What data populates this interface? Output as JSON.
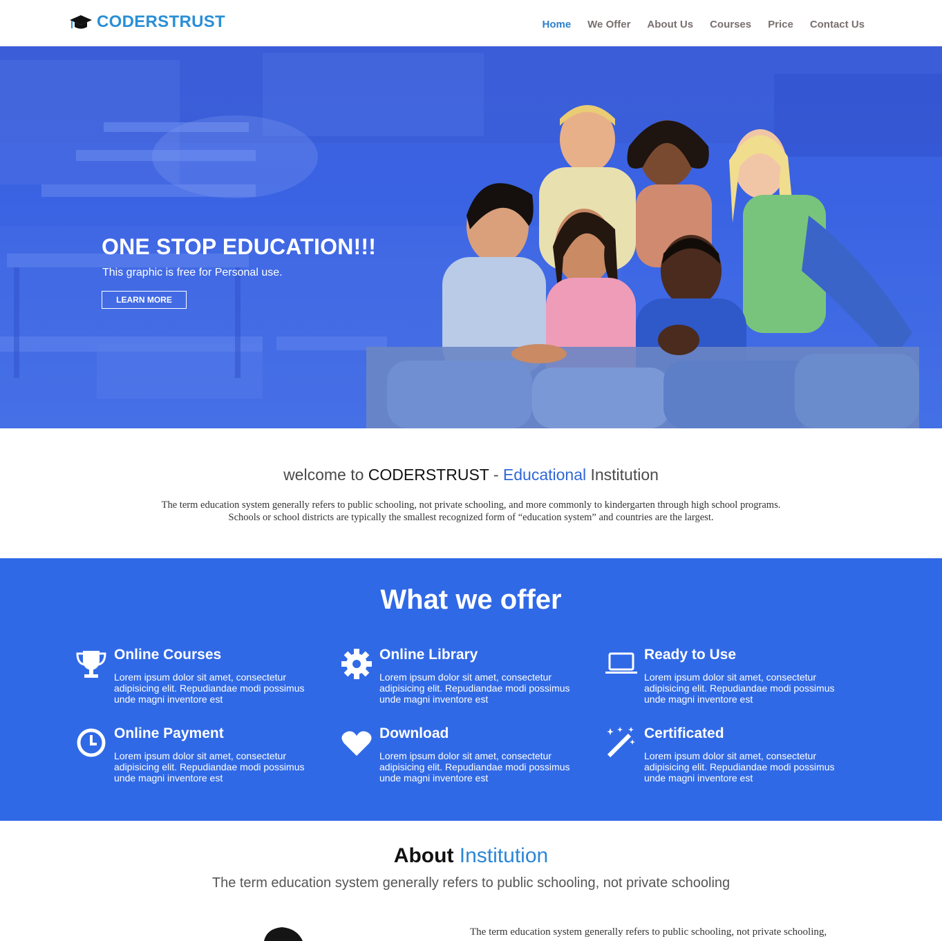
{
  "nav": {
    "brand": "CODERSTRUST",
    "items": [
      {
        "label": "Home",
        "active": true
      },
      {
        "label": "We Offer"
      },
      {
        "label": "About Us"
      },
      {
        "label": "Courses"
      },
      {
        "label": "Price"
      },
      {
        "label": "Contact Us"
      }
    ]
  },
  "hero": {
    "title": "ONE STOP EDUCATION!!!",
    "subtitle": "This graphic is free for Personal use.",
    "button": "LEARN MORE"
  },
  "welcome": {
    "prefix": "welcome to ",
    "brand": "CODERSTRUST",
    "dash": " - ",
    "highlight": "Educational",
    "suffix": " Institution",
    "text_line1": "The term education system generally refers to public schooling, not private schooling, and more commonly to kindergarten through high school programs.",
    "text_line2": "Schools or school districts are typically the smallest recognized form of “education system” and countries are the largest."
  },
  "offer": {
    "title": "What we offer",
    "features": [
      {
        "icon": "trophy-icon",
        "title": "Online Courses",
        "text": "Lorem ipsum dolor sit amet, consectetur adipisicing elit. Repudiandae modi possimus unde magni inventore est"
      },
      {
        "icon": "gear-icon",
        "title": "Online Library",
        "text": "Lorem ipsum dolor sit amet, consectetur adipisicing elit. Repudiandae modi possimus unde magni inventore est"
      },
      {
        "icon": "laptop-icon",
        "title": "Ready to Use",
        "text": "Lorem ipsum dolor sit amet, consectetur adipisicing elit. Repudiandae modi possimus unde magni inventore est"
      },
      {
        "icon": "clock-icon",
        "title": "Online Payment",
        "text": "Lorem ipsum dolor sit amet, consectetur adipisicing elit. Repudiandae modi possimus unde magni inventore est"
      },
      {
        "icon": "heart-icon",
        "title": "Download",
        "text": "Lorem ipsum dolor sit amet, consectetur adipisicing elit. Repudiandae modi possimus unde magni inventore est"
      },
      {
        "icon": "magic-wand-icon",
        "title": "Certificated",
        "text": "Lorem ipsum dolor sit amet, consectetur adipisicing elit. Repudiandae modi possimus unde magni inventore est"
      }
    ]
  },
  "about": {
    "title": "About",
    "highlight": "Institution",
    "subtitle": "The term education system generally refers to public schooling, not private schooling",
    "text": "The term education system generally refers to public schooling, not private schooling,"
  },
  "colors": {
    "accent": "#3069e6",
    "brand": "#2a8fd6",
    "nav_active": "#2b7fcc"
  }
}
